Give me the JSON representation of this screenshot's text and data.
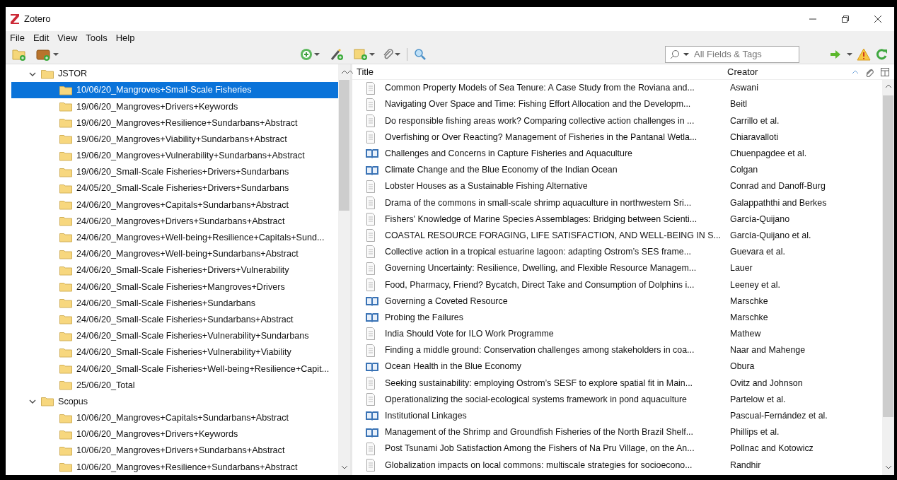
{
  "window": {
    "title": "Zotero"
  },
  "menu": [
    "File",
    "Edit",
    "View",
    "Tools",
    "Help"
  ],
  "search": {
    "placeholder": "All Fields & Tags"
  },
  "collections": [
    {
      "label": "JSTOR",
      "expanded": true,
      "selected": false,
      "children": [
        {
          "label": "10/06/20_Mangroves+Small-Scale Fisheries",
          "selected": true
        },
        {
          "label": "19/06/20_Mangroves+Drivers+Keywords",
          "selected": false
        },
        {
          "label": "19/06/20_Mangroves+Resilience+Sundarbans+Abstract",
          "selected": false
        },
        {
          "label": "19/06/20_Mangroves+Viability+Sundarbans+Abstract",
          "selected": false
        },
        {
          "label": "19/06/20_Mangroves+Vulnerability+Sundarbans+Abstract",
          "selected": false
        },
        {
          "label": "19/06/20_Small-Scale Fisheries+Drivers+Sundarbans",
          "selected": false
        },
        {
          "label": "24/05/20_Small-Scale Fisheries+Drivers+Sundarbans",
          "selected": false
        },
        {
          "label": "24/06/20_Mangroves+Capitals+Sundarbans+Abstract",
          "selected": false
        },
        {
          "label": "24/06/20_Mangroves+Drivers+Sundarbans+Abstract",
          "selected": false
        },
        {
          "label": "24/06/20_Mangroves+Well-being+Resilience+Capitals+Sund...",
          "selected": false
        },
        {
          "label": "24/06/20_Mangroves+Well-being+Sundarbans+Abstract",
          "selected": false
        },
        {
          "label": "24/06/20_Small-Scale Fisheries+Drivers+Vulnerability",
          "selected": false
        },
        {
          "label": "24/06/20_Small-Scale Fisheries+Mangroves+Drivers",
          "selected": false
        },
        {
          "label": "24/06/20_Small-Scale Fisheries+Sundarbans",
          "selected": false
        },
        {
          "label": "24/06/20_Small-Scale Fisheries+Sundarbans+Abstract",
          "selected": false
        },
        {
          "label": "24/06/20_Small-Scale Fisheries+Vulnerability+Sundarbans",
          "selected": false
        },
        {
          "label": "24/06/20_Small-Scale Fisheries+Vulnerability+Viability",
          "selected": false
        },
        {
          "label": "24/06/20_Small-Scale Fisheries+Well-being+Resilience+Capit...",
          "selected": false
        },
        {
          "label": "25/06/20_Total",
          "selected": false
        }
      ]
    },
    {
      "label": "Scopus",
      "expanded": true,
      "selected": false,
      "children": [
        {
          "label": "10/06/20_Mangroves+Capitals+Sundarbans+Abstract",
          "selected": false
        },
        {
          "label": "10/06/20_Mangroves+Drivers+Keywords",
          "selected": false
        },
        {
          "label": "10/06/20_Mangroves+Drivers+Sundarbans+Abstract",
          "selected": false
        },
        {
          "label": "10/06/20_Mangroves+Resilience+Sundarbans+Abstract",
          "selected": false
        }
      ]
    }
  ],
  "columns": [
    "Title",
    "Creator"
  ],
  "items": [
    {
      "kind": "document",
      "title": "Common Property Models of Sea Tenure: A Case Study from the Roviana and...",
      "creator": "Aswani"
    },
    {
      "kind": "document",
      "title": "Navigating Over Space and Time: Fishing Effort Allocation and the Developm...",
      "creator": "Beitl"
    },
    {
      "kind": "document",
      "title": "Do responsible fishing areas work? Comparing collective action challenges in ...",
      "creator": "Carrillo et al."
    },
    {
      "kind": "document",
      "title": "Overfishing or Over Reacting? Management of Fisheries in the Pantanal Wetla...",
      "creator": "Chiaravalloti"
    },
    {
      "kind": "book",
      "title": "Challenges and Concerns in Capture Fisheries and Aquaculture",
      "creator": "Chuenpagdee et al."
    },
    {
      "kind": "book",
      "title": "Climate Change and the Blue Economy of the Indian Ocean",
      "creator": "Colgan"
    },
    {
      "kind": "document",
      "title": "Lobster Houses as a Sustainable Fishing Alternative",
      "creator": "Conrad and Danoff-Burg"
    },
    {
      "kind": "document",
      "title": "Drama of the commons in small-scale shrimp aquaculture in northwestern Sri...",
      "creator": "Galappaththi and Berkes"
    },
    {
      "kind": "document",
      "title": "Fishers' Knowledge of Marine Species Assemblages: Bridging between Scienti...",
      "creator": "García-Quijano"
    },
    {
      "kind": "document",
      "title": "COASTAL RESOURCE FORAGING, LIFE SATISFACTION, AND WELL-BEING IN S...",
      "creator": "García-Quijano et al."
    },
    {
      "kind": "document",
      "title": "Collective action in a tropical estuarine lagoon: adapting Ostrom’s SES frame...",
      "creator": "Guevara et al."
    },
    {
      "kind": "document",
      "title": "Governing Uncertainty: Resilience, Dwelling, and Flexible Resource Managem...",
      "creator": "Lauer"
    },
    {
      "kind": "document",
      "title": "Food, Pharmacy, Friend? Bycatch, Direct Take and Consumption of Dolphins i...",
      "creator": "Leeney et al."
    },
    {
      "kind": "book",
      "title": "Governing a Coveted Resource",
      "creator": "Marschke"
    },
    {
      "kind": "book",
      "title": "Probing the Failures",
      "creator": "Marschke"
    },
    {
      "kind": "document",
      "title": "India Should Vote for ILO Work Programme",
      "creator": "Mathew"
    },
    {
      "kind": "document",
      "title": "Finding a middle ground: Conservation challenges among stakeholders in coa...",
      "creator": "Naar and Mahenge"
    },
    {
      "kind": "book",
      "title": "Ocean Health in the Blue Economy",
      "creator": "Obura"
    },
    {
      "kind": "document",
      "title": "Seeking sustainability: employing Ostrom’s SESF to explore spatial fit in Main...",
      "creator": "Ovitz and Johnson"
    },
    {
      "kind": "document",
      "title": "Operationalizing the social-ecological systems framework in pond aquaculture",
      "creator": "Partelow et al."
    },
    {
      "kind": "book",
      "title": "Institutional Linkages",
      "creator": "Pascual-Fernández et al."
    },
    {
      "kind": "book",
      "title": "Management of the Shrimp and Groundfish Fisheries of the North Brazil Shelf...",
      "creator": "Phillips et al."
    },
    {
      "kind": "document",
      "title": "Post Tsunami Job Satisfaction Among the Fishers of Na Pru Village, on the An...",
      "creator": "Pollnac and Kotowicz"
    },
    {
      "kind": "document",
      "title": "Globalization impacts on local commons: multiscale strategies for socioecono...",
      "creator": "Randhir"
    }
  ]
}
